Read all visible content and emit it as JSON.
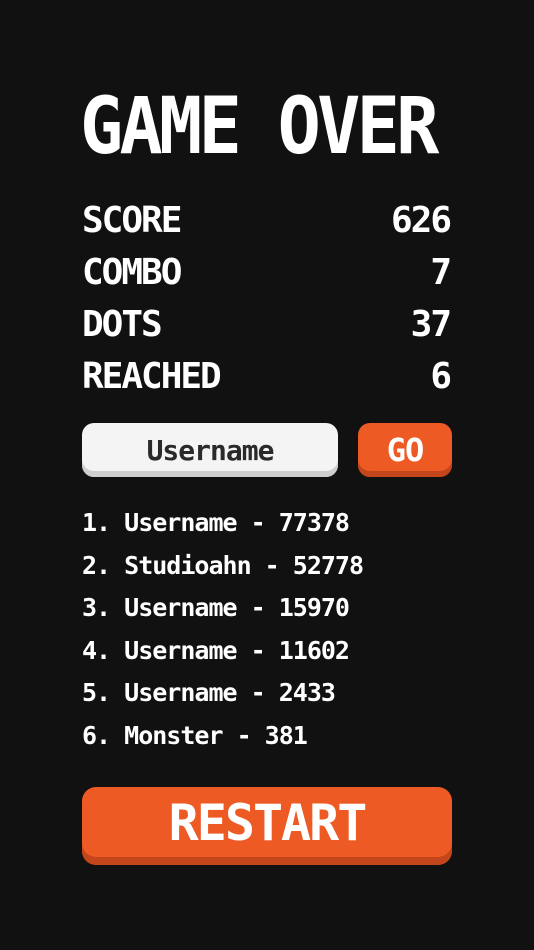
{
  "title": "GAME OVER",
  "stats": [
    {
      "label": "SCORE",
      "value": "626"
    },
    {
      "label": "COMBO",
      "value": "7"
    },
    {
      "label": "DOTS",
      "value": "37"
    },
    {
      "label": "REACHED",
      "value": "6"
    }
  ],
  "name_entry": {
    "placeholder": "Username",
    "value": ""
  },
  "go_label": "GO",
  "leaderboard": [
    "1. Username - 77378",
    "2. Studioahn - 52778",
    "3. Username - 15970",
    "4. Username - 11602",
    "5. Username - 2433",
    "6. Monster - 381"
  ],
  "restart_label": "RESTART",
  "colors": {
    "background": "#111111",
    "accent": "#ee5a24",
    "text": "#ffffff",
    "field": "#f4f4f4"
  }
}
